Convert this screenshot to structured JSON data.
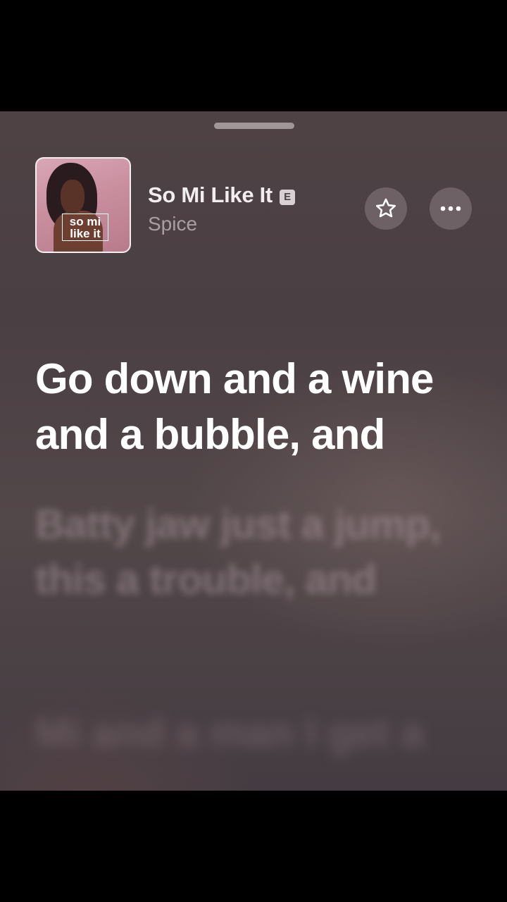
{
  "song": {
    "title": "So Mi Like It",
    "explicit_badge": "E",
    "artist": "Spice",
    "artwork_text": "so mi\nlike it"
  },
  "actions": {
    "favorite_icon": "star-outline-icon",
    "more_icon": "ellipsis-icon"
  },
  "lyrics": {
    "current": "Go down and a wine and a bubble, and",
    "next": "Batty jaw just a jump, this a trouble, and",
    "following": "Mi and a man I get a"
  },
  "colors": {
    "background": "#4a3f43",
    "lyric_active": "#ffffff",
    "lyric_inactive": "#aa969c"
  }
}
